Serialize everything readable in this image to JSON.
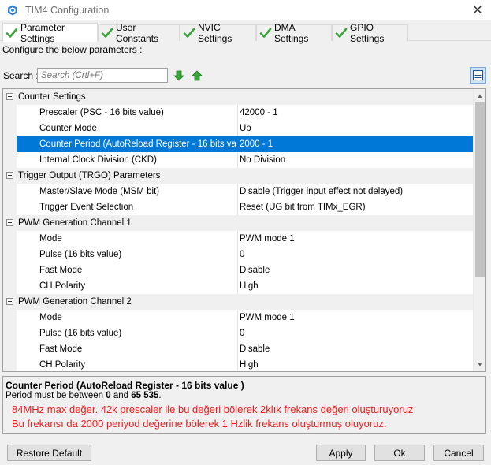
{
  "window": {
    "title": "TIM4 Configuration",
    "icon": "stm32cube-icon",
    "close_glyph": "✕"
  },
  "tabs": [
    {
      "label": "Parameter Settings",
      "active": true
    },
    {
      "label": "User Constants",
      "active": false
    },
    {
      "label": "NVIC Settings",
      "active": false
    },
    {
      "label": "DMA Settings",
      "active": false
    },
    {
      "label": "GPIO Settings",
      "active": false
    }
  ],
  "configure_label": "Configure the below parameters :",
  "search": {
    "label": "Search :",
    "placeholder": "Search (Crtl+F)"
  },
  "grid": {
    "rows": [
      {
        "type": "category",
        "label": "Counter Settings"
      },
      {
        "type": "property",
        "name": "Prescaler (PSC - 16 bits value)",
        "value": "42000 - 1"
      },
      {
        "type": "property",
        "name": "Counter Mode",
        "value": "Up"
      },
      {
        "type": "property",
        "name": "Counter Period (AutoReload Register - 16 bits val...",
        "value": "2000 - 1",
        "selected": true
      },
      {
        "type": "property",
        "name": "Internal Clock Division (CKD)",
        "value": "No Division"
      },
      {
        "type": "category",
        "label": "Trigger Output (TRGO) Parameters"
      },
      {
        "type": "property",
        "name": "Master/Slave Mode (MSM bit)",
        "value": "Disable (Trigger input effect not delayed)"
      },
      {
        "type": "property",
        "name": "Trigger Event Selection",
        "value": "Reset (UG bit from TIMx_EGR)"
      },
      {
        "type": "category",
        "label": "PWM Generation Channel 1"
      },
      {
        "type": "property",
        "name": "Mode",
        "value": "PWM mode 1"
      },
      {
        "type": "property",
        "name": "Pulse (16 bits value)",
        "value": "0"
      },
      {
        "type": "property",
        "name": "Fast Mode",
        "value": "Disable"
      },
      {
        "type": "property",
        "name": "CH Polarity",
        "value": "High"
      },
      {
        "type": "category",
        "label": "PWM Generation Channel 2"
      },
      {
        "type": "property",
        "name": "Mode",
        "value": "PWM mode 1"
      },
      {
        "type": "property",
        "name": "Pulse (16 bits value)",
        "value": "0"
      },
      {
        "type": "property",
        "name": "Fast Mode",
        "value": "Disable"
      },
      {
        "type": "property",
        "name": "CH Polarity",
        "value": "High"
      }
    ]
  },
  "description": {
    "title": "Counter Period (AutoReload Register - 16 bits value )",
    "text_prefix": "Period must be between ",
    "min": "0",
    "text_mid": " and ",
    "max": "65 535",
    "text_suffix": ".",
    "annotation_line1": "84MHz max değer. 42k prescaler ile bu değeri bölerek 2klık frekans değeri oluşturuyoruz",
    "annotation_line2": "Bu frekansı da 2000 periyod değerine bölerek 1 Hzlik frekans oluşturmuş oluyoruz.",
    "annotation_color": "#ee1c1c"
  },
  "buttons": {
    "restore_default": "Restore Default",
    "apply": "Apply",
    "ok": "Ok",
    "cancel": "Cancel"
  },
  "colors": {
    "selection": "#0078d7",
    "check_green": "#3aa33a"
  }
}
